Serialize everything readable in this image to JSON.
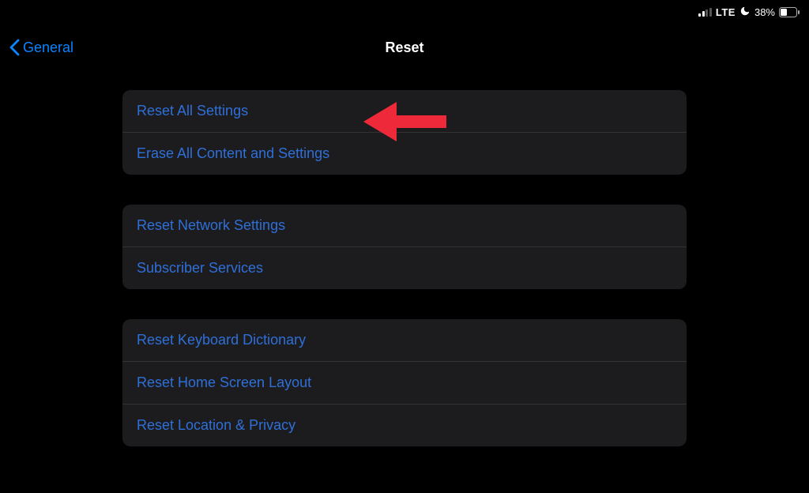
{
  "status_bar": {
    "network_type": "LTE",
    "battery_percent": "38%"
  },
  "nav": {
    "back_label": "General",
    "title": "Reset"
  },
  "groups": [
    {
      "items": [
        {
          "label": "Reset All Settings",
          "name": "reset-all-settings"
        },
        {
          "label": "Erase All Content and Settings",
          "name": "erase-all-content"
        }
      ]
    },
    {
      "items": [
        {
          "label": "Reset Network Settings",
          "name": "reset-network-settings"
        },
        {
          "label": "Subscriber Services",
          "name": "subscriber-services"
        }
      ]
    },
    {
      "items": [
        {
          "label": "Reset Keyboard Dictionary",
          "name": "reset-keyboard-dictionary"
        },
        {
          "label": "Reset Home Screen Layout",
          "name": "reset-home-screen-layout"
        },
        {
          "label": "Reset Location & Privacy",
          "name": "reset-location-privacy"
        }
      ]
    }
  ]
}
